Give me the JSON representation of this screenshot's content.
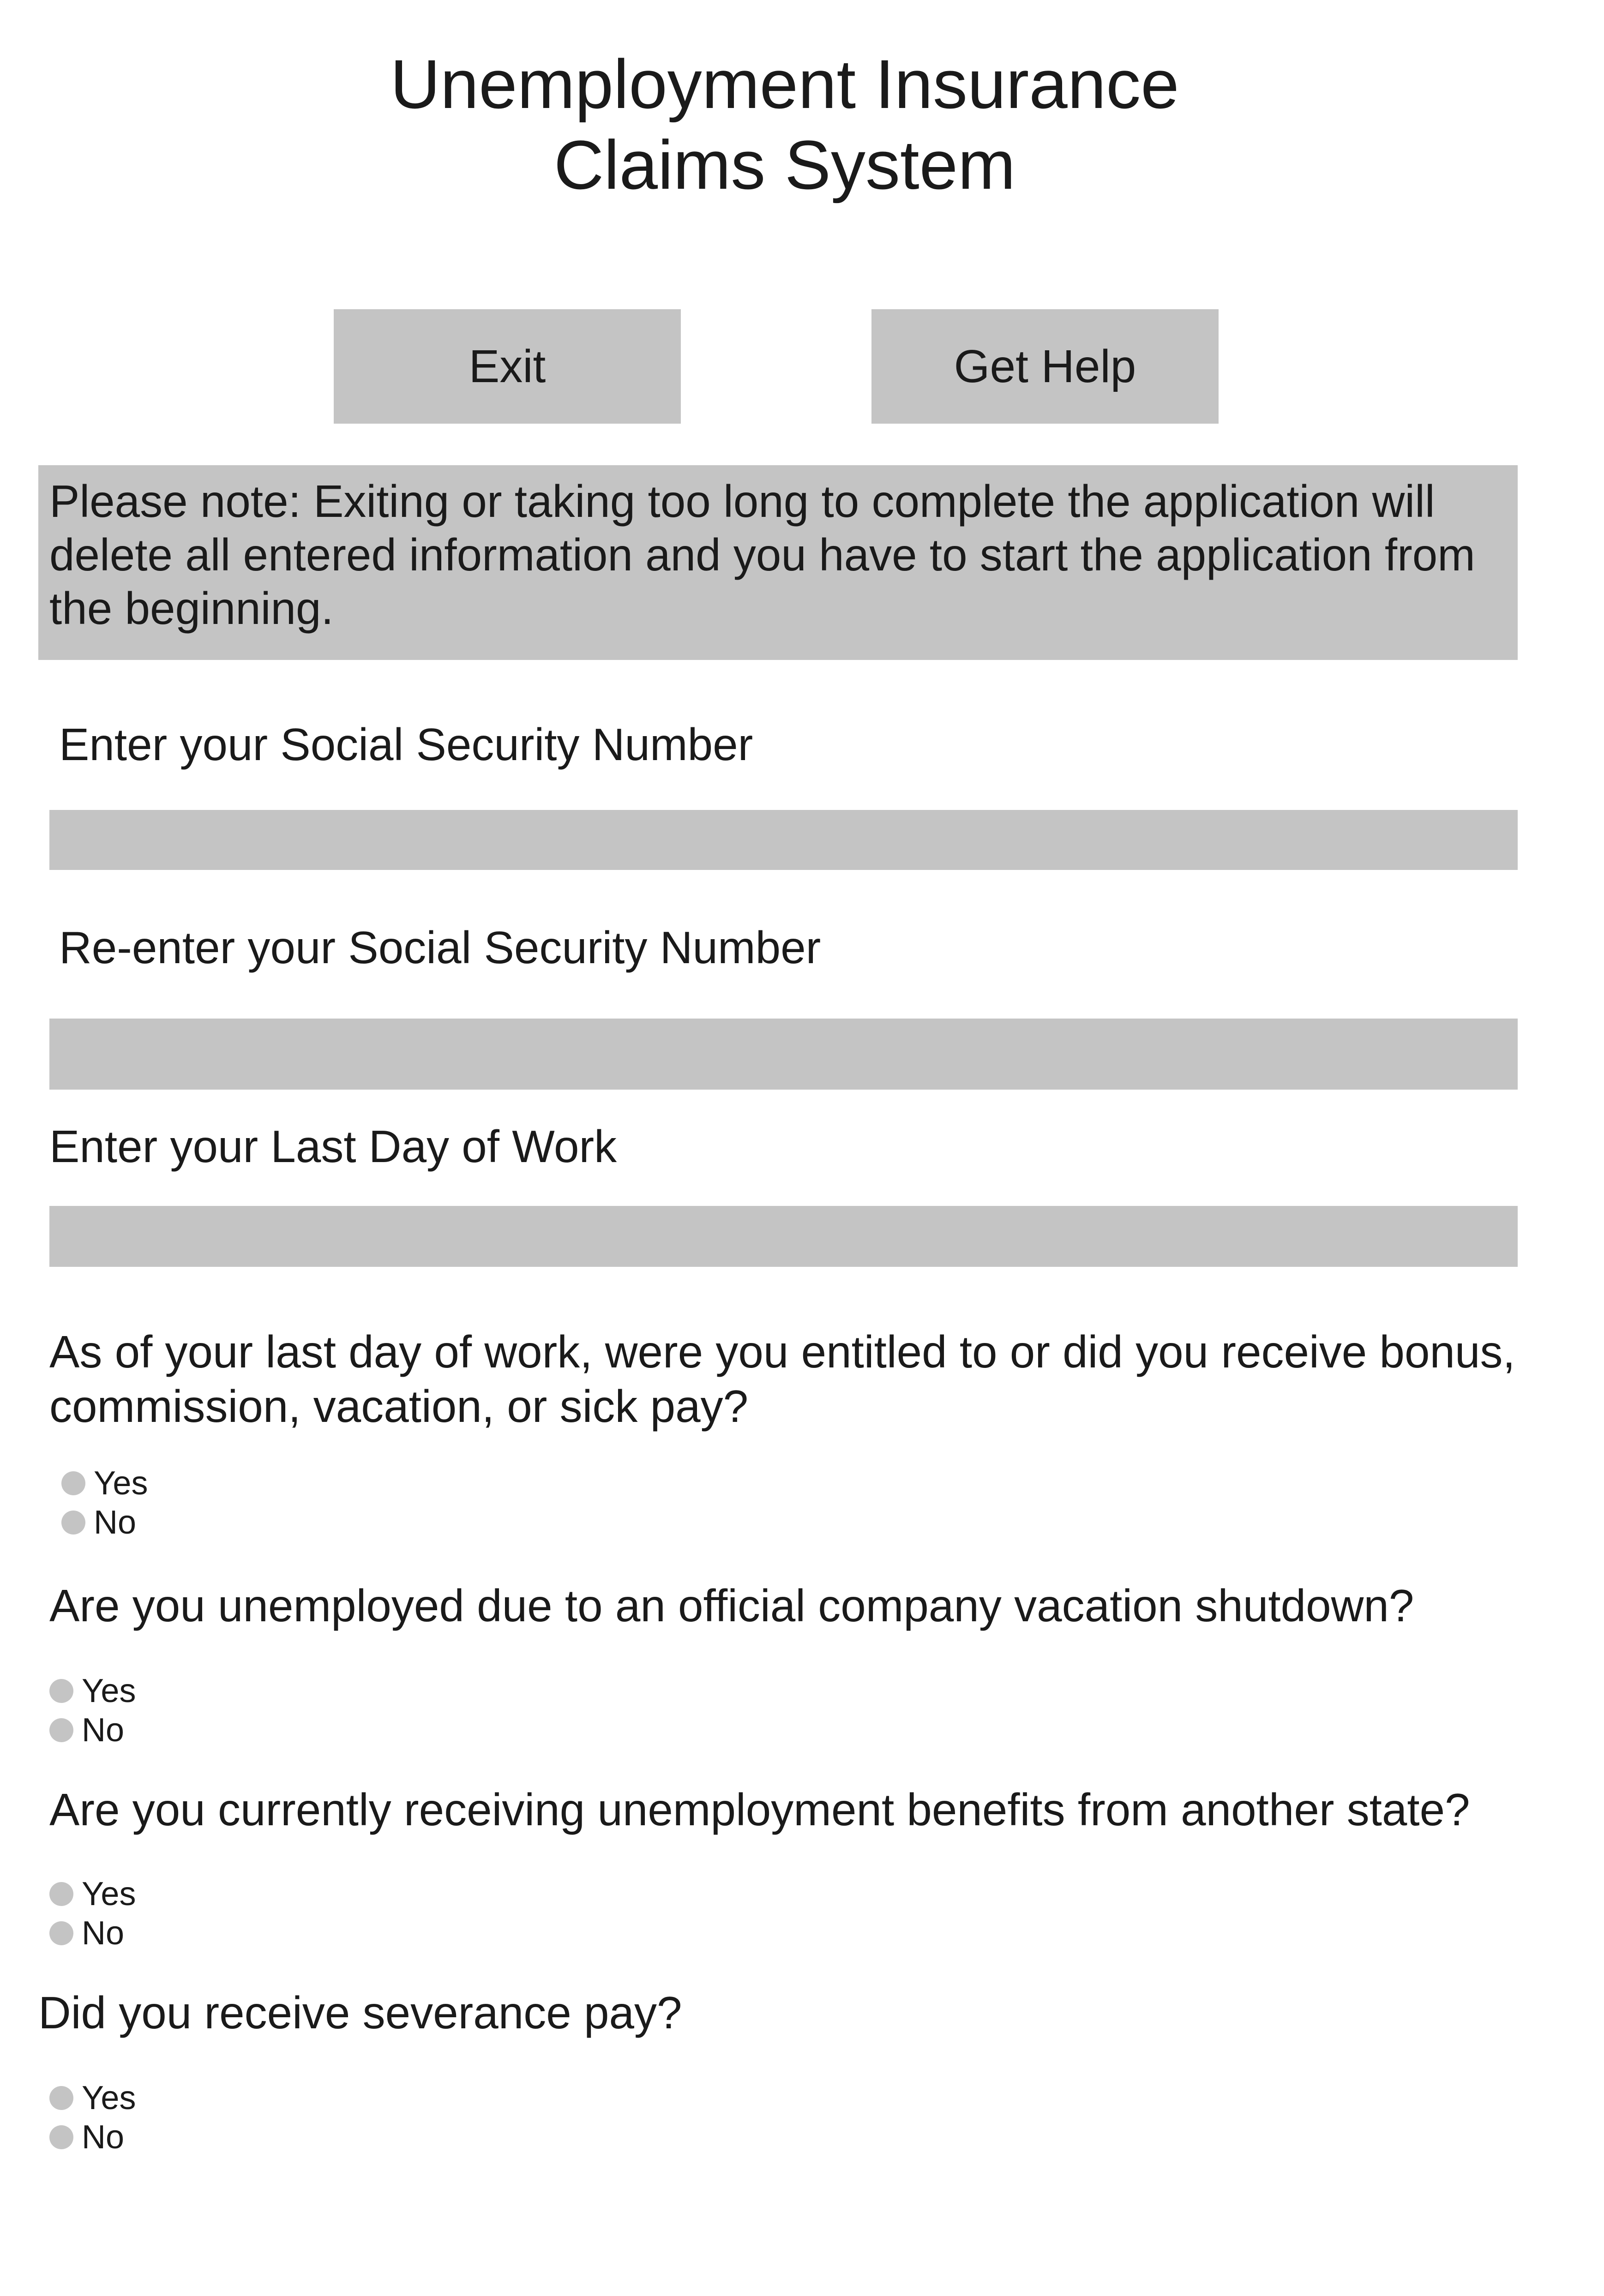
{
  "header": {
    "title": "Unemployment Insurance\nClaims System"
  },
  "actions": {
    "exit_label": "Exit",
    "help_label": "Get Help"
  },
  "notice": {
    "text": "Please note: Exiting or taking too long to complete the application will delete all entered information and you have to start the application from the beginning."
  },
  "fields": {
    "ssn": {
      "label": "Enter your Social Security Number",
      "value": ""
    },
    "ssn_confirm": {
      "label": "Re-enter your Social Security Number",
      "value": ""
    },
    "last_day": {
      "label": "Enter your Last Day of Work",
      "value": ""
    }
  },
  "questions": [
    {
      "text": "As of your last day of work, were you entitled to or did you receive bonus, commission, vacation, or sick pay?",
      "options": [
        "Yes",
        "No"
      ]
    },
    {
      "text": "Are you unemployed due to an official company vacation shutdown?",
      "options": [
        "Yes",
        "No"
      ]
    },
    {
      "text": "Are you currently receiving unemployment benefits from another state?",
      "options": [
        "Yes",
        "No"
      ]
    },
    {
      "text": "Did you receive severance pay?",
      "options": [
        "Yes",
        "No"
      ]
    }
  ],
  "colors": {
    "control_fill": "#c4c4c4",
    "text": "#1a1a1a",
    "background": "#ffffff"
  }
}
